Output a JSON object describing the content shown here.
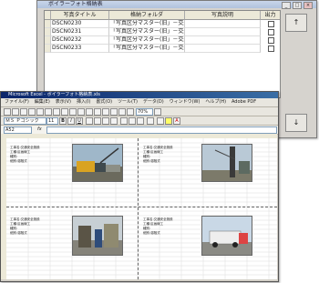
{
  "dialog": {
    "title": "ボイラーフォト格納表",
    "columns": [
      "写真タイトル",
      "格納フォルダ",
      "写真説明",
      "出力"
    ],
    "rows": [
      {
        "title": "DSCN0230",
        "folder": "「写真区分マスター(旧」－交通",
        "desc": ""
      },
      {
        "title": "DSCN0231",
        "folder": "「写真区分マスター(旧」－交通",
        "desc": ""
      },
      {
        "title": "DSCN0232",
        "folder": "「写真区分マスター(旧」－交通",
        "desc": ""
      },
      {
        "title": "DSCN0233",
        "folder": "「写真区分マスター(旧」－交通",
        "desc": ""
      }
    ],
    "up_button": "↑",
    "down_button": "↓",
    "close_button": "×",
    "max_button": "□",
    "min_button": "_"
  },
  "excel": {
    "title": "Microsoft Excel - ボイラーフォト格納表.xls",
    "menu": [
      "ファイル(F)",
      "編集(E)",
      "表示(V)",
      "挿入(I)",
      "書式(O)",
      "ツール(T)",
      "データ(D)",
      "ウィンドウ(W)",
      "ヘルプ(H)",
      "Adobe PDF"
    ],
    "font_name": "ＭＳ Ｐゴシック",
    "font_size": "11",
    "name_box": "A52",
    "formula_fx": "fx",
    "zoom": "70%",
    "photo_notes": [
      "工事名:交通安全施設\n工種:区画線工\n種別:\n細別:溶融式",
      "工事名:交通安全施設\n工種:区画線工\n種別:\n細別:溶融式",
      "工事名:交通安全施設\n工種:区画線工\n種別:\n細別:溶融式",
      "工事名:交通安全施設\n工種:区画線工\n種別:\n細別:溶融式"
    ]
  }
}
